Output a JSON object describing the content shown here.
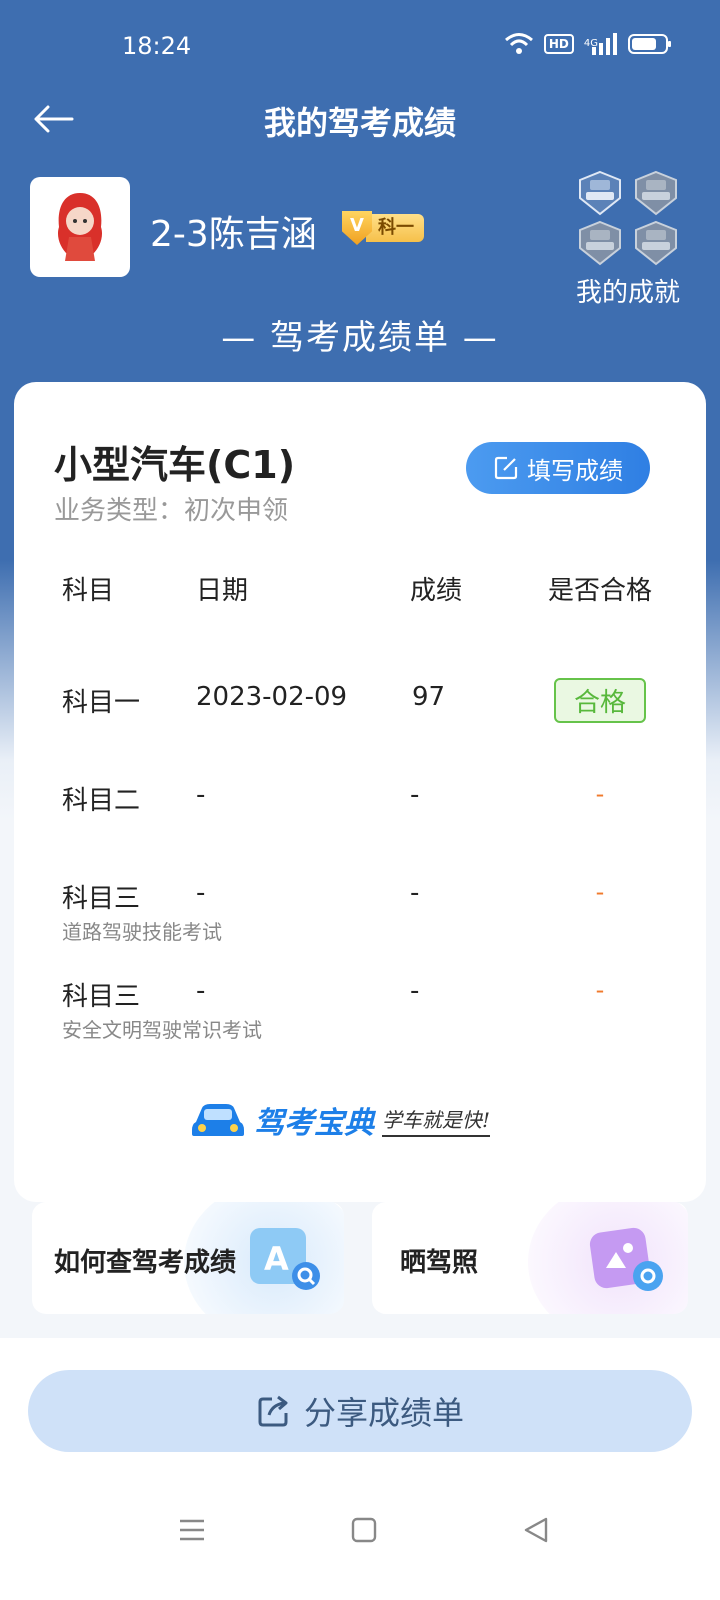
{
  "status_bar": {
    "time": "18:24",
    "hd_label": "HD",
    "network_label": "4G"
  },
  "nav": {
    "title": "我的驾考成绩"
  },
  "user": {
    "name": "2-3陈吉涵",
    "badge_v": "V",
    "badge_text": "科一"
  },
  "achievements": {
    "label": "我的成就",
    "badges": [
      "科一通过",
      "科二通过",
      "科三通过",
      "科四通过"
    ]
  },
  "report_heading": "— 驾考成绩单 —",
  "card": {
    "license_type": "小型汽车(C1)",
    "business_type": "业务类型：初次申领",
    "fill_button_label": "填写成绩",
    "headers": {
      "subject": "科目",
      "date": "日期",
      "score": "成绩",
      "passed": "是否合格"
    },
    "rows": [
      {
        "subject": "科目一",
        "sub_label": "",
        "date": "2023-02-09",
        "score": "97",
        "passed": "合格"
      },
      {
        "subject": "科目二",
        "sub_label": "",
        "date": "-",
        "score": "-",
        "passed": "-"
      },
      {
        "subject": "科目三",
        "sub_label": "道路驾驶技能考试",
        "date": "-",
        "score": "-",
        "passed": "-"
      },
      {
        "subject": "科目三",
        "sub_label": "安全文明驾驶常识考试",
        "date": "-",
        "score": "-",
        "passed": "-"
      }
    ],
    "brand_name": "驾考宝典",
    "brand_slogan": "学车就是快!"
  },
  "promos": [
    {
      "label": "如何查驾考成绩",
      "icon": "search-doc-icon"
    },
    {
      "label": "晒驾照",
      "icon": "photo-camera-icon"
    }
  ],
  "share_button_label": "分享成绩单",
  "colors": {
    "primary_blue": "#3e6eb0",
    "accent_blue": "#2f7fe3",
    "pass_green": "#58b83c",
    "dash_orange": "#f07a2c",
    "share_bg": "#cfe1f8"
  }
}
